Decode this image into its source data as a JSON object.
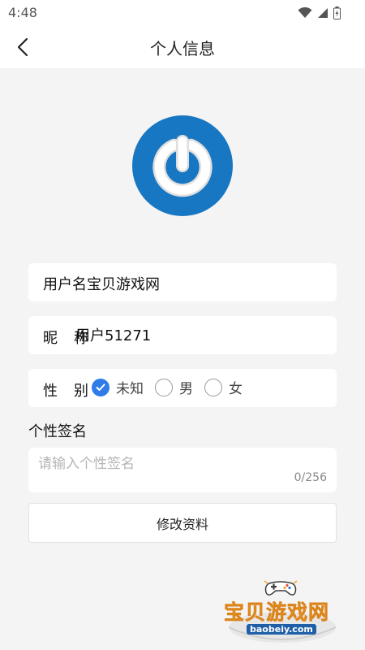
{
  "status_bar": {
    "time": "4:48"
  },
  "header": {
    "title": "个人信息"
  },
  "profile": {
    "username_text": "用户名宝贝游戏网",
    "nickname_label": "昵称",
    "nickname_value": "用户51271",
    "gender_label": "性别",
    "gender_options": [
      "未知",
      "男",
      "女"
    ],
    "gender_selected": "未知",
    "signature_label": "个性签名",
    "signature_placeholder": "请输入个性签名",
    "signature_value": "",
    "signature_counter": "0/256",
    "submit_label": "修改资料"
  },
  "watermark": {
    "title": "宝贝游戏网",
    "domain": "baobeiy.com"
  },
  "colors": {
    "avatar_blue": "#1877c2",
    "radio_checked": "#2f7ce8",
    "watermark_orange": "#f5a623"
  },
  "icons": [
    "wifi-icon",
    "signal-icon",
    "battery-icon",
    "back-arrow-icon",
    "power-logo-icon",
    "checkmark-icon",
    "gamepad-icon"
  ]
}
